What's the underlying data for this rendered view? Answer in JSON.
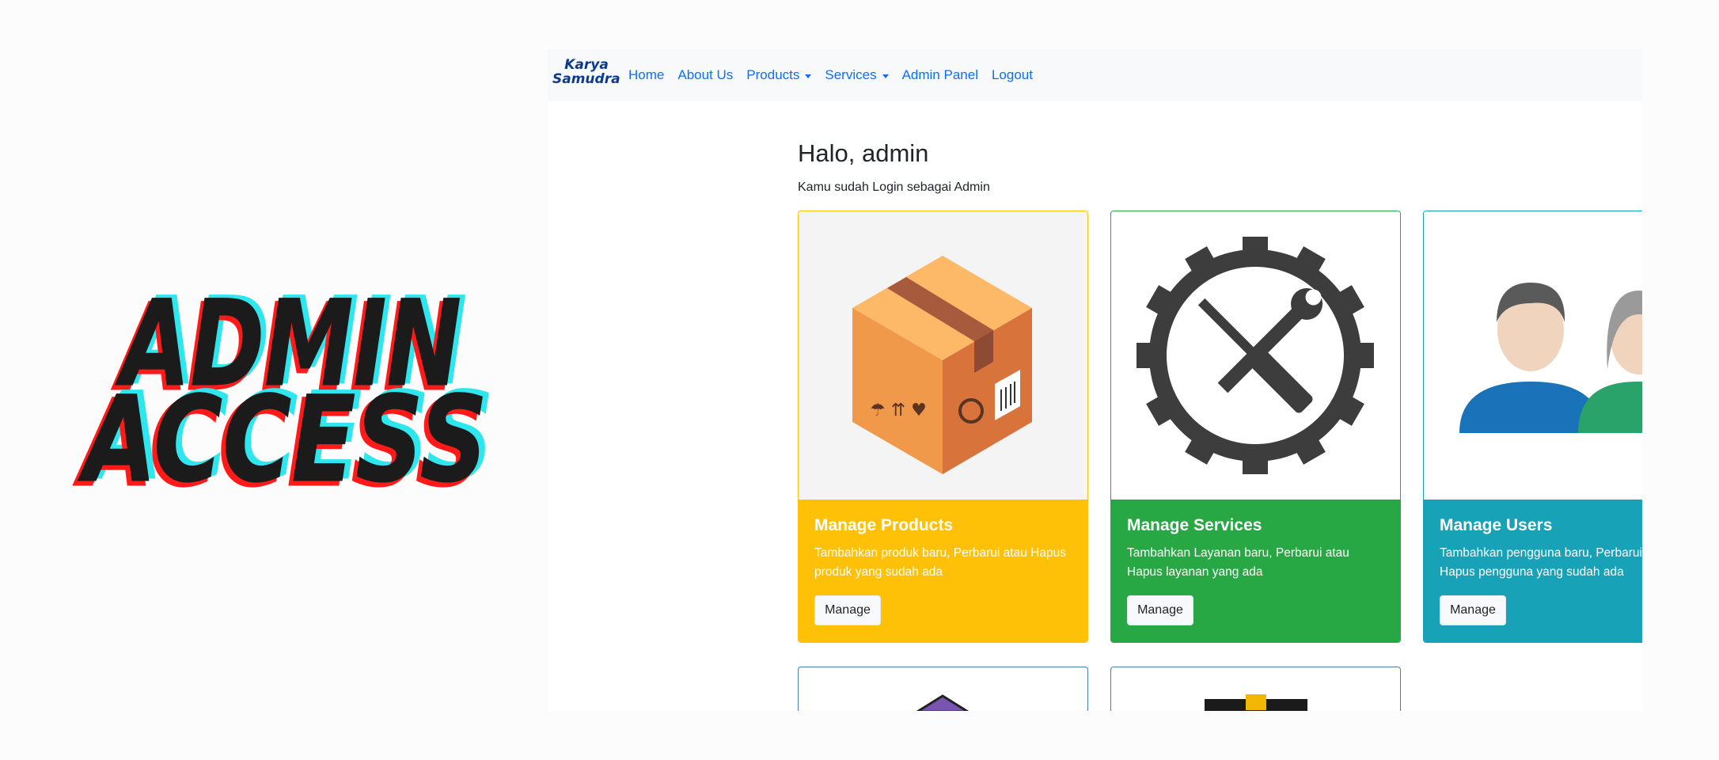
{
  "banner": {
    "line1": "ADMIN",
    "line2": "ACCESS"
  },
  "navbar": {
    "brand_line1": "Karya",
    "brand_line2": "Samudra",
    "links": [
      "Home",
      "About Us",
      "Products",
      "Services",
      "Admin Panel",
      "Logout"
    ]
  },
  "main": {
    "greeting": "Halo, admin",
    "subtitle": "Kamu sudah Login sebagai Admin"
  },
  "cards": [
    {
      "title": "Manage Products",
      "text": "Tambahkan produk baru, Perbarui atau Hapus produk yang sudah ada",
      "button": "Manage",
      "color": "#ffc107"
    },
    {
      "title": "Manage Services",
      "text": "Tambahkan Layanan baru, Perbarui atau Hapus layanan yang ada",
      "button": "Manage",
      "color": "#28a745"
    },
    {
      "title": "Manage Users",
      "text": "Tambahkan pengguna baru, Perbarui atau Hapus pengguna yang sudah ada",
      "button": "Manage",
      "color": "#17a2b8"
    }
  ],
  "colors": {
    "link": "#0d6efd",
    "navbar_bg": "#f8f9fa"
  }
}
